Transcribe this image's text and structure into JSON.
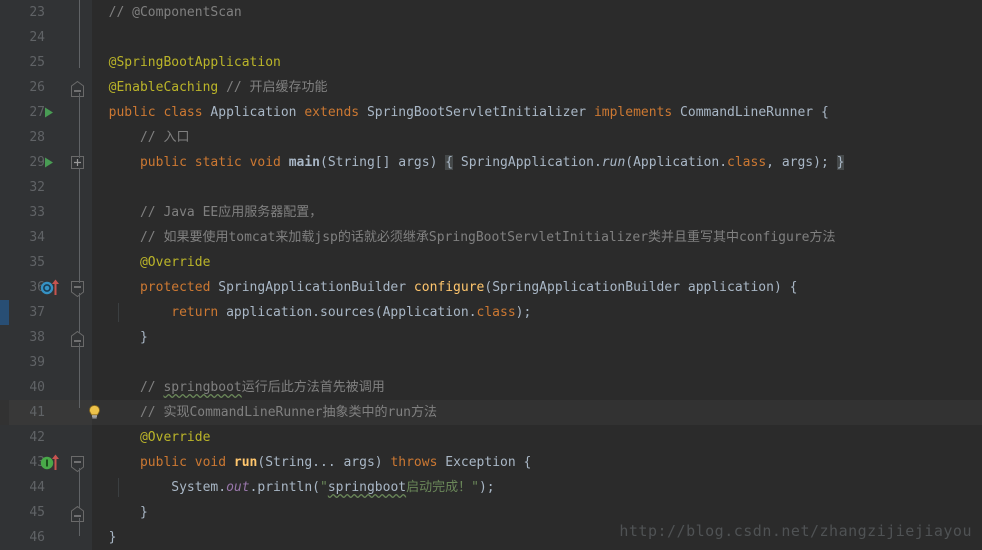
{
  "editor": {
    "theme_name": "darcula",
    "background": "#2B2B2B",
    "gutter_background": "#313335",
    "current_line": 41,
    "colors": {
      "keyword": "#CC7832",
      "annotation": "#BBB529",
      "comment": "#808080",
      "string": "#6A8759",
      "method": "#FFC66D",
      "text": "#A9B7C6",
      "line_number": "#606366",
      "field": "#9876AA",
      "change_marker": "#284E74"
    },
    "watermark": "http://blog.csdn.net/zhangzijiejiayou",
    "lines": [
      {
        "number": "23",
        "tokens": [
          {
            "t": "  ",
            "c": "txt"
          },
          {
            "t": "// @ComponentScan",
            "c": "cmt"
          }
        ]
      },
      {
        "number": "24",
        "tokens": []
      },
      {
        "number": "25",
        "tokens": [
          {
            "t": "  ",
            "c": "txt"
          },
          {
            "t": "@SpringBootApplication",
            "c": "ann"
          }
        ]
      },
      {
        "number": "26",
        "fold": "collapse-top",
        "tokens": [
          {
            "t": "  ",
            "c": "txt"
          },
          {
            "t": "@EnableCaching",
            "c": "ann"
          },
          {
            "t": " ",
            "c": "txt"
          },
          {
            "t": "// 开启缓存功能",
            "c": "cmt"
          }
        ]
      },
      {
        "number": "27",
        "run": true,
        "tokens": [
          {
            "t": "  ",
            "c": "txt"
          },
          {
            "t": "public",
            "c": "kw"
          },
          {
            "t": " ",
            "c": "txt"
          },
          {
            "t": "class",
            "c": "kw"
          },
          {
            "t": " Application ",
            "c": "txt"
          },
          {
            "t": "extends",
            "c": "kw"
          },
          {
            "t": " SpringBootServletInitializer ",
            "c": "txt"
          },
          {
            "t": "implements",
            "c": "kw"
          },
          {
            "t": " CommandLineRunner {",
            "c": "txt"
          }
        ]
      },
      {
        "number": "28",
        "tokens": [
          {
            "t": "      ",
            "c": "txt"
          },
          {
            "t": "// 入口",
            "c": "cmt"
          }
        ]
      },
      {
        "number": "29",
        "run": true,
        "fold": "expand",
        "tokens": [
          {
            "t": "      ",
            "c": "txt"
          },
          {
            "t": "public",
            "c": "kw"
          },
          {
            "t": " ",
            "c": "txt"
          },
          {
            "t": "static",
            "c": "kw"
          },
          {
            "t": " ",
            "c": "txt"
          },
          {
            "t": "void",
            "c": "kw"
          },
          {
            "t": " ",
            "c": "txt"
          },
          {
            "t": "main",
            "c": "mainfn"
          },
          {
            "t": "(String[] args)",
            "c": "txt"
          },
          {
            "t": " ",
            "c": "txt"
          },
          {
            "t": "{",
            "c": "brace-box"
          },
          {
            "t": " SpringApplication.",
            "c": "txt"
          },
          {
            "t": "run",
            "c": "static-it"
          },
          {
            "t": "(Application.",
            "c": "txt"
          },
          {
            "t": "class",
            "c": "kw"
          },
          {
            "t": ", args);",
            "c": "txt"
          },
          {
            "t": " ",
            "c": "txt"
          },
          {
            "t": "}",
            "c": "brace-box"
          }
        ]
      },
      {
        "number": "32",
        "tokens": []
      },
      {
        "number": "33",
        "tokens": [
          {
            "t": "      ",
            "c": "txt"
          },
          {
            "t": "// Java EE应用服务器配置，",
            "c": "cmt"
          }
        ]
      },
      {
        "number": "34",
        "tokens": [
          {
            "t": "      ",
            "c": "txt"
          },
          {
            "t": "// 如果要使用tomcat来加载jsp的话就必须继承SpringBootServletInitializer类并且重写其中configure方法",
            "c": "cmt"
          }
        ]
      },
      {
        "number": "35",
        "tokens": [
          {
            "t": "      ",
            "c": "txt"
          },
          {
            "t": "@Override",
            "c": "ann"
          }
        ]
      },
      {
        "number": "36",
        "marker": "override",
        "fold": "collapse-bottom",
        "tokens": [
          {
            "t": "      ",
            "c": "txt"
          },
          {
            "t": "protected",
            "c": "kw"
          },
          {
            "t": " SpringApplicationBuilder ",
            "c": "txt"
          },
          {
            "t": "configure",
            "c": "fn"
          },
          {
            "t": "(SpringApplicationBuilder application) {",
            "c": "txt"
          }
        ]
      },
      {
        "number": "37",
        "changed": true,
        "tokens": [
          {
            "t": "          ",
            "c": "txt"
          },
          {
            "t": "return",
            "c": "kw"
          },
          {
            "t": " application.sources(Application.",
            "c": "txt"
          },
          {
            "t": "class",
            "c": "kw"
          },
          {
            "t": ");",
            "c": "txt"
          }
        ]
      },
      {
        "number": "38",
        "fold": "collapse-top",
        "tokens": [
          {
            "t": "      }",
            "c": "txt"
          }
        ]
      },
      {
        "number": "39",
        "tokens": []
      },
      {
        "number": "40",
        "tokens": [
          {
            "t": "      ",
            "c": "txt"
          },
          {
            "t": "// ",
            "c": "cmt"
          },
          {
            "t": "springboot",
            "c": "typo-gray"
          },
          {
            "t": "运行后此方法首先被调用",
            "c": "cmt"
          }
        ]
      },
      {
        "number": "41",
        "bulb": true,
        "current": true,
        "tokens": [
          {
            "t": "      ",
            "c": "txt"
          },
          {
            "t": "// 实现CommandLineRunner抽象类中的run方法",
            "c": "cmt"
          }
        ]
      },
      {
        "number": "42",
        "tokens": [
          {
            "t": "      ",
            "c": "txt"
          },
          {
            "t": "@Override",
            "c": "ann"
          }
        ]
      },
      {
        "number": "43",
        "marker": "implement",
        "fold": "collapse-bottom",
        "tokens": [
          {
            "t": "      ",
            "c": "txt"
          },
          {
            "t": "public",
            "c": "kw"
          },
          {
            "t": " ",
            "c": "txt"
          },
          {
            "t": "void",
            "c": "kw"
          },
          {
            "t": " ",
            "c": "txt"
          },
          {
            "t": "run",
            "c": "fnb"
          },
          {
            "t": "(String... args) ",
            "c": "txt"
          },
          {
            "t": "throws",
            "c": "kw"
          },
          {
            "t": " Exception {",
            "c": "txt"
          }
        ]
      },
      {
        "number": "44",
        "tokens": [
          {
            "t": "          ",
            "c": "txt"
          },
          {
            "t": "System.",
            "c": "txt"
          },
          {
            "t": "out",
            "c": "field"
          },
          {
            "t": ".println(",
            "c": "txt"
          },
          {
            "t": "\"",
            "c": "str"
          },
          {
            "t": "springboot",
            "c": "typo"
          },
          {
            "t": "启动完成！\"",
            "c": "str"
          },
          {
            "t": ");",
            "c": "txt"
          }
        ]
      },
      {
        "number": "45",
        "fold": "collapse-top",
        "tokens": [
          {
            "t": "      }",
            "c": "txt"
          }
        ]
      },
      {
        "number": "46",
        "tokens": [
          {
            "t": "  }",
            "c": "txt"
          }
        ]
      }
    ]
  },
  "icons": {
    "run": "run-triangle-icon",
    "override": "overriding-method-icon",
    "implement": "implementing-method-icon",
    "bulb": "intention-bulb-icon",
    "fold_expand": "fold-expand-icon",
    "fold_collapse": "fold-collapse-icon"
  }
}
